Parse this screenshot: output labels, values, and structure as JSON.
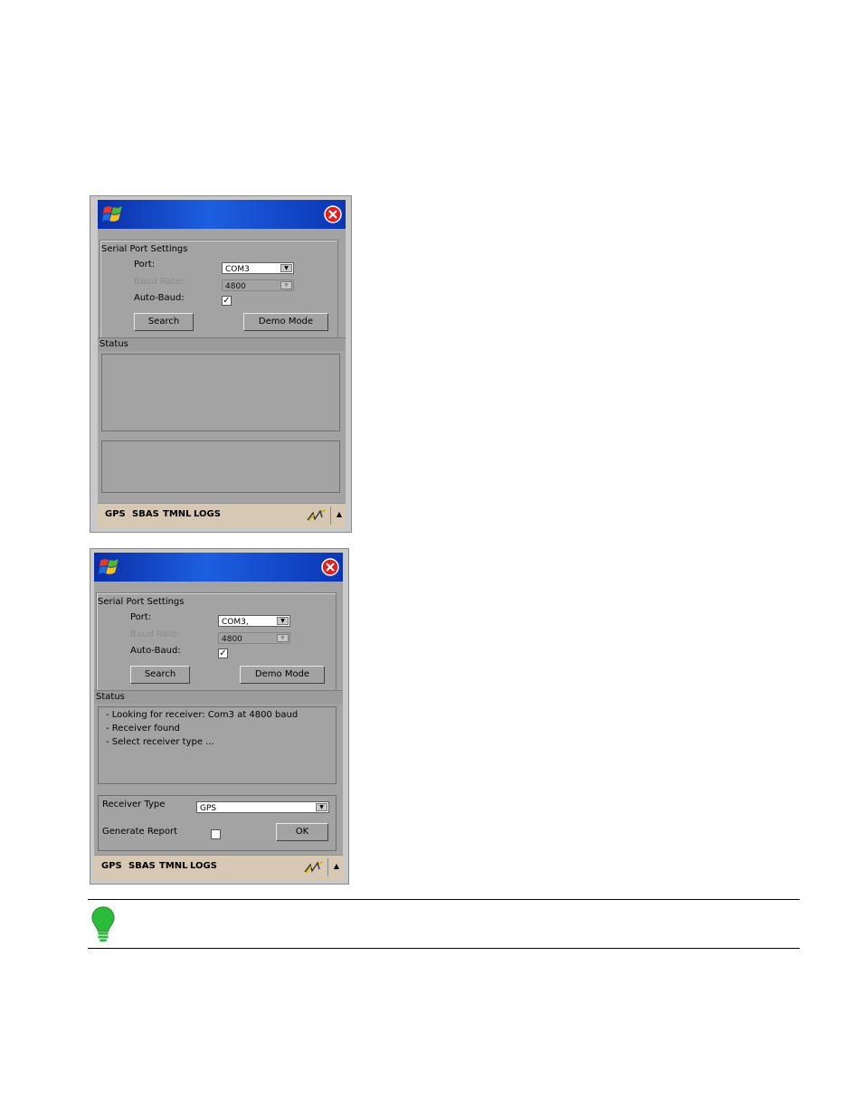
{
  "screen1": {
    "serial_port_settings": "Serial Port Settings",
    "port_label": "Port:",
    "port_value": "COM3",
    "baud_label": "Baud Rate:",
    "baud_value": "4800",
    "autobaud_label": "Auto-Baud:",
    "autobaud_checked": "✓",
    "search_button": "Search",
    "demo_button": "Demo Mode",
    "status_label": "Status",
    "menu": [
      "GPS",
      "SBAS",
      "TMNL",
      "LOGS"
    ]
  },
  "screen2": {
    "serial_port_settings": "Serial Port Settings",
    "port_label": "Port:",
    "port_value": "COM3,",
    "baud_label": "Baud Rate:",
    "baud_value": "4800",
    "autobaud_label": "Auto-Baud:",
    "autobaud_checked": "✓",
    "search_button": "Search",
    "demo_button": "Demo Mode",
    "status_label": "Status",
    "status_lines": [
      "- Looking for receiver: Com3 at 4800 baud",
      "- Receiver found",
      "- Select receiver type ..."
    ],
    "receiver_type_label": "Receiver Type",
    "receiver_type_value": "GPS",
    "generate_report_label": "Generate Report",
    "ok_button": "OK",
    "menu": [
      "GPS",
      "SBAS",
      "TMNL",
      "LOGS"
    ]
  },
  "icons": {
    "start": "windows-flag-icon",
    "close": "close-icon",
    "connection": "connectivity-icon",
    "tip": "lightbulb-icon"
  },
  "colors": {
    "titlebar": "#1d5fe0",
    "close": "#e02020",
    "taskbar": "#d7c8b4",
    "tip": "#2dbb3c"
  }
}
